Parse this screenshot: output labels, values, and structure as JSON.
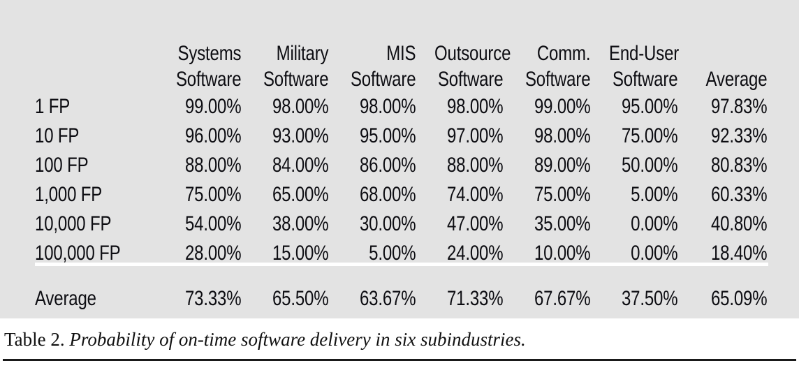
{
  "table": {
    "row_header_label": "",
    "columns": [
      {
        "line1": "Systems",
        "line2": "Software"
      },
      {
        "line1": "Military",
        "line2": "Software"
      },
      {
        "line1": "MIS",
        "line2": "Software"
      },
      {
        "line1": "Outsource",
        "line2": "Software"
      },
      {
        "line1": "Comm.",
        "line2": "Software"
      },
      {
        "line1": "End-User",
        "line2": "Software"
      },
      {
        "line1": "Average",
        "line2": ""
      }
    ],
    "rows": [
      {
        "label": "1 FP",
        "values": [
          "99.00%",
          "98.00%",
          "98.00%",
          "98.00%",
          "99.00%",
          "95.00%",
          "97.83%"
        ]
      },
      {
        "label": "10 FP",
        "values": [
          "96.00%",
          "93.00%",
          "95.00%",
          "97.00%",
          "98.00%",
          "75.00%",
          "92.33%"
        ]
      },
      {
        "label": "100 FP",
        "values": [
          "88.00%",
          "84.00%",
          "86.00%",
          "88.00%",
          "89.00%",
          "50.00%",
          "80.83%"
        ]
      },
      {
        "label": "1,000 FP",
        "values": [
          "75.00%",
          "65.00%",
          "68.00%",
          "74.00%",
          "75.00%",
          "5.00%",
          "60.33%"
        ]
      },
      {
        "label": "10,000 FP",
        "values": [
          "54.00%",
          "38.00%",
          "30.00%",
          "47.00%",
          "35.00%",
          "0.00%",
          "40.80%"
        ]
      },
      {
        "label": "100,000 FP",
        "values": [
          "28.00%",
          "15.00%",
          "5.00%",
          "24.00%",
          "10.00%",
          "0.00%",
          "18.40%"
        ]
      }
    ],
    "summary_row": {
      "label": "Average",
      "values": [
        "73.33%",
        "65.50%",
        "63.67%",
        "71.33%",
        "67.67%",
        "37.50%",
        "65.09%"
      ]
    }
  },
  "caption": {
    "lead": "Table 2.",
    "body": " Probability of on-time software delivery in six subindustries."
  },
  "colors": {
    "panel_background": "#e3e3e3",
    "page_background": "#ffffff",
    "text": "#0d0d12",
    "separator_rule": "#ffffff",
    "bottom_rule": "#1a1a1a"
  }
}
